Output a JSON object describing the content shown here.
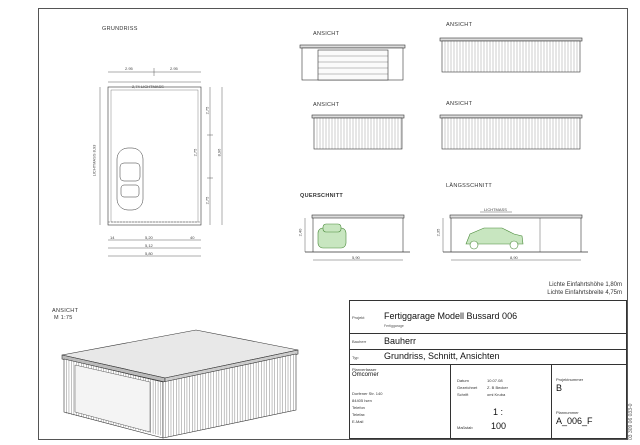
{
  "labels": {
    "grundriss": "GRUNDRISS",
    "ansicht_1": "ANSICHT",
    "ansicht_2": "ANSICHT",
    "ansicht_3": "ANSICHT",
    "ansicht_4": "ANSICHT",
    "querschnitt": "QUERSCHNITT",
    "laengsschnitt": "LÄNGSSCHNITT",
    "ansicht_iso": "ANSICHT",
    "ansicht_iso_scale": "M 1:75"
  },
  "dims": {
    "top_left": "2.95",
    "top_right": "2.95",
    "inner_width": "2,74 LICHTMASS",
    "left_vertical": "LICHTMASS 8,93",
    "right_a": "2,75",
    "right_b": "2,75",
    "right_total": "8,96",
    "right_c": "2,75",
    "bottom_a": "5,20",
    "bottom_b": "5,12",
    "bottom_total": "5,80",
    "bottom_small_l": "14",
    "bottom_small_r": "40",
    "qs_height": "2,40",
    "qs_width": "5,90",
    "ls_height": "2,35",
    "ls_width": "8,90",
    "ls_top": "LICHTMASS"
  },
  "clearances": {
    "line1": "Lichte Einfahrtshöhe 1,80m",
    "line2": "Lichte Einfahrtsbreite 4,75m"
  },
  "titleblock": {
    "projekt_key": "Projekt",
    "projekt": "Fertiggarage Modell Bussard 006",
    "projekt_sub": "Fertiggarage",
    "bauherr_key": "Bauherr",
    "bauherr": "Bauherr",
    "typ_key": "Typ",
    "typ": "Grundriss, Schnitt, Ansichten",
    "company_l1": "Planverfasser",
    "company_l2": "Omcorner",
    "addr_l1": "Dorfener Str. 140",
    "addr_l2": "84405 Isen",
    "addr_l3": "Telefon",
    "addr_l4": "Telefax",
    "addr_l5": "E-Mail",
    "datum_key": "Datum",
    "datum": "10.07.08",
    "gez_key": "Gezeichnet",
    "gez": "Z. B Becker",
    "schrift_key": "Schrift",
    "schrift": "omi Kruba",
    "massstab_key": "Maßstab",
    "scale_top": "1 :",
    "scale_bottom": "100",
    "projektnummer_key": "Projektnummer",
    "projektnummer": "B",
    "plannummer_key": "Plannummer",
    "plannummer": "A_006_F"
  },
  "side_code": "03 309 06 033-0"
}
